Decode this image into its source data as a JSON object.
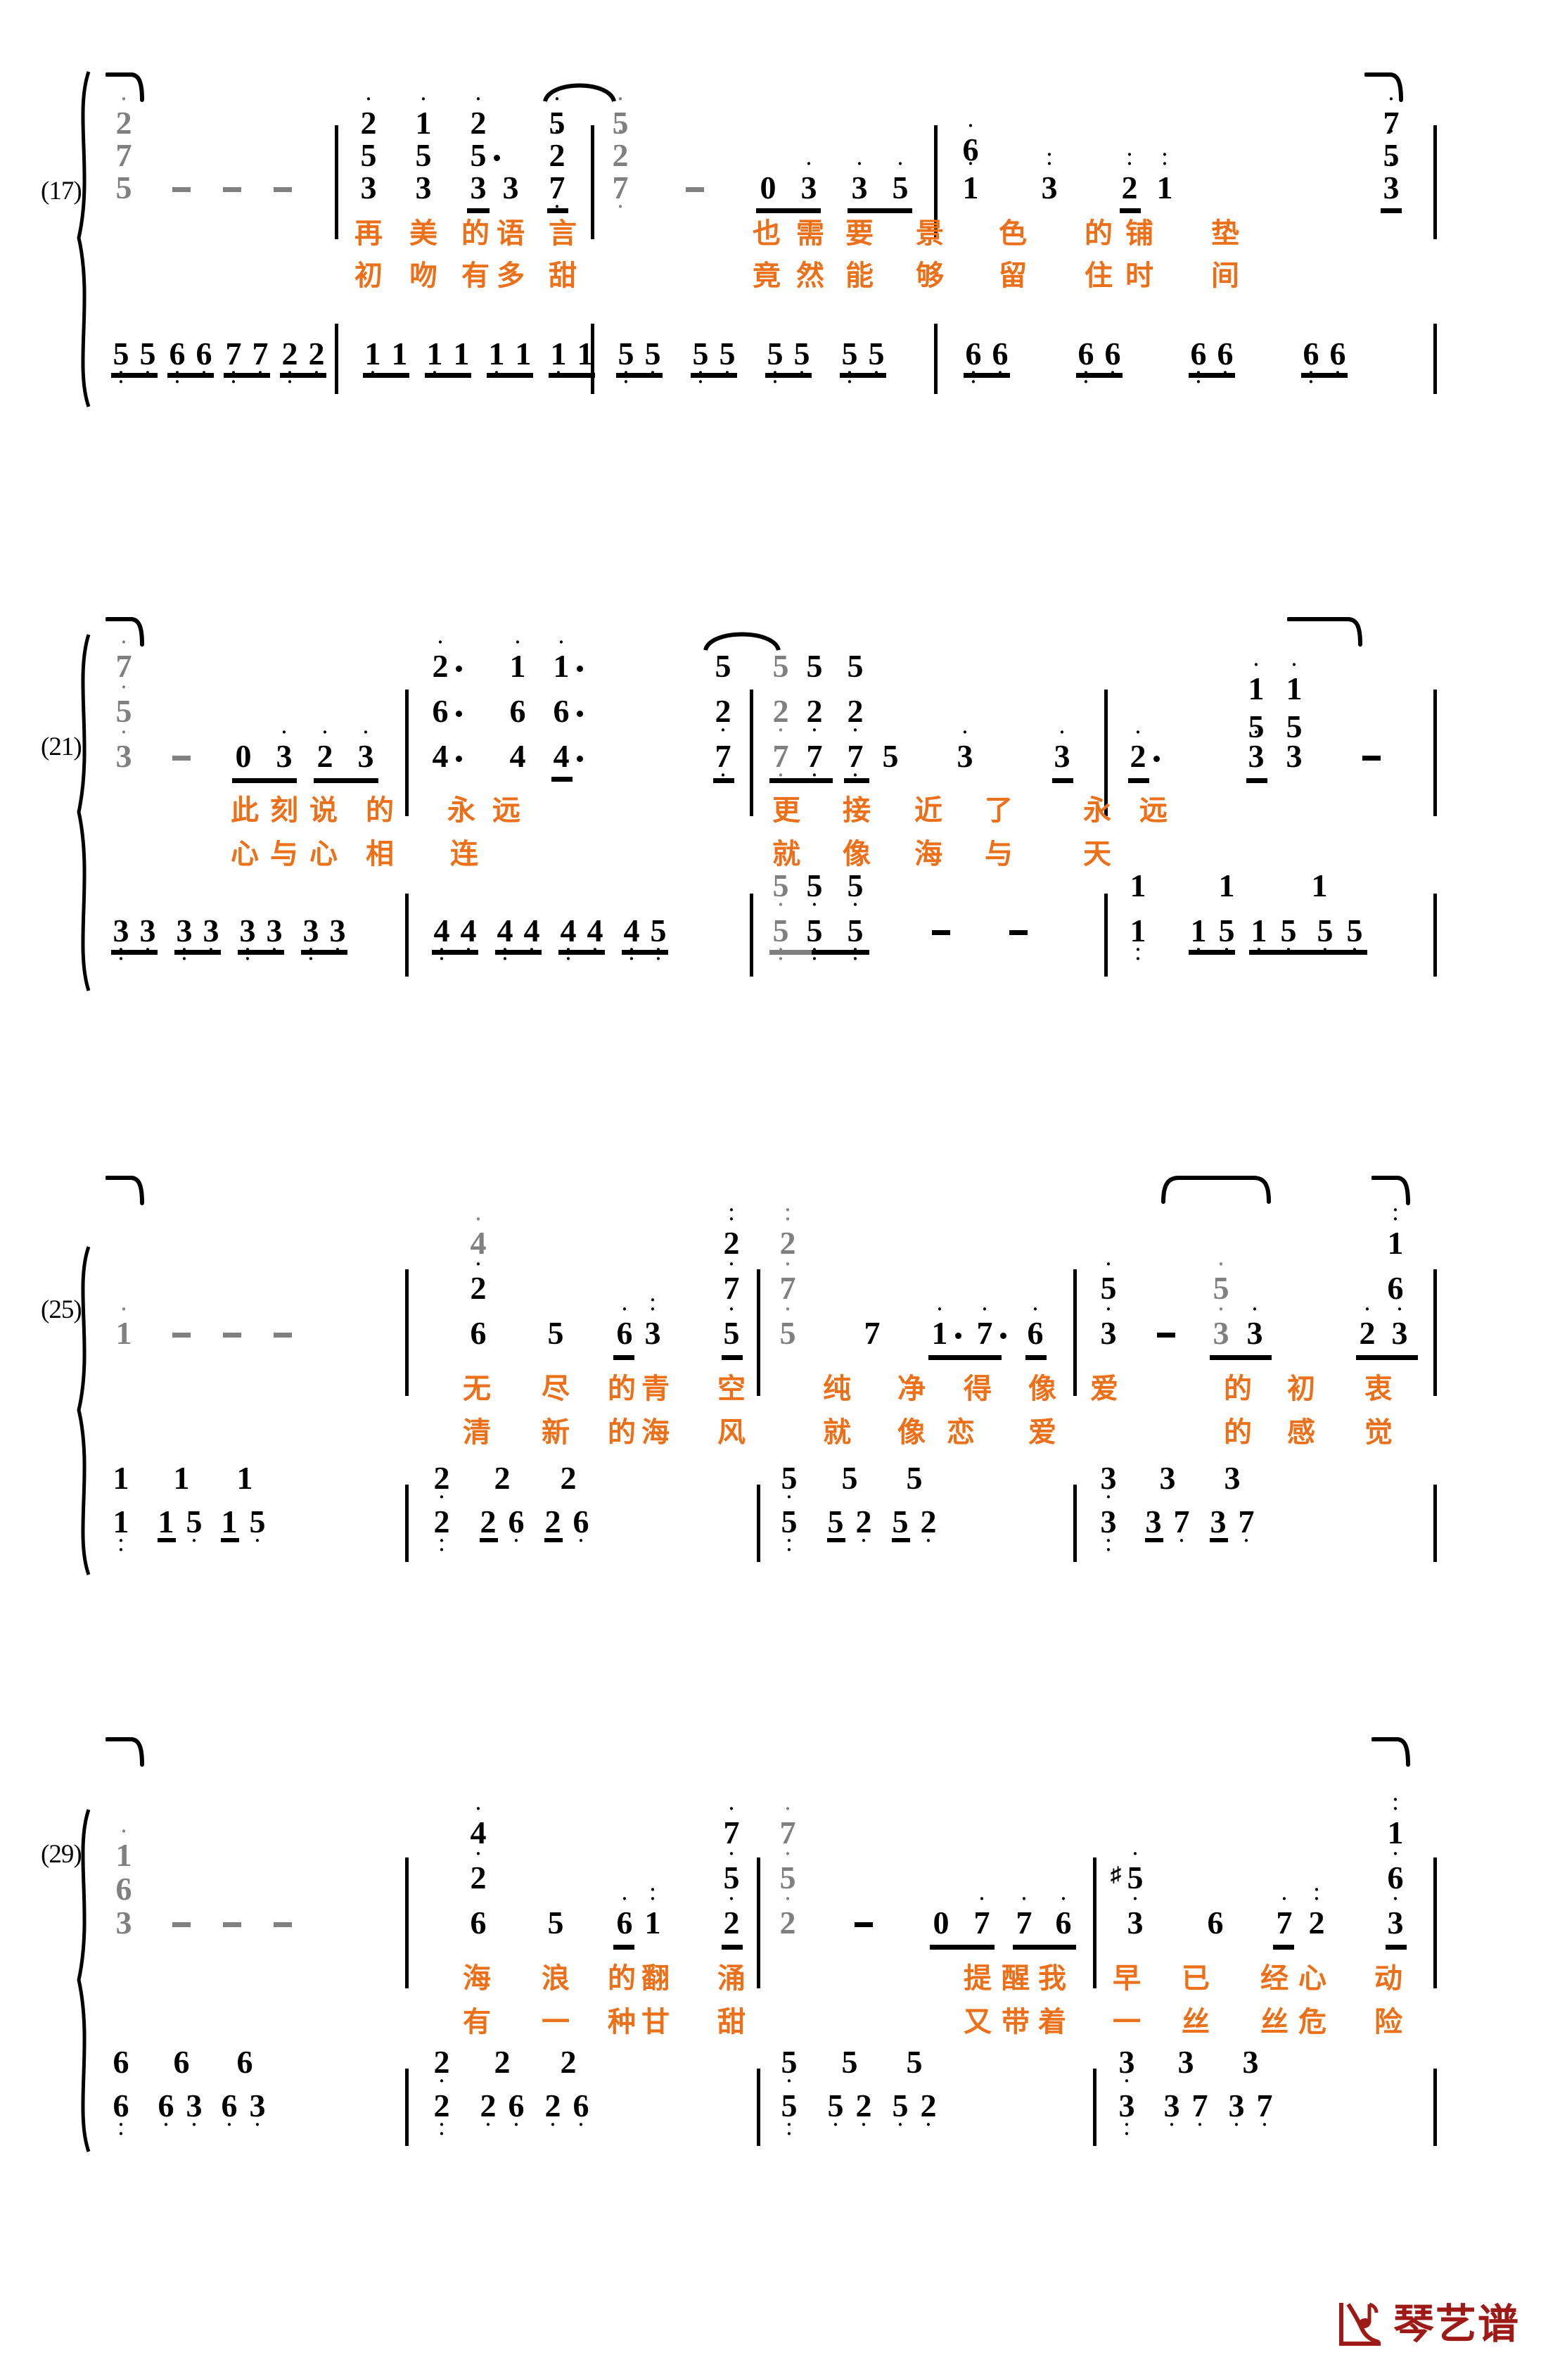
{
  "document": {
    "kind": "jianpu-piano-score",
    "notation": "Chinese numbered musical notation (简谱)",
    "accent_color": "#ec7019",
    "chord_grey_color": "#808080",
    "logo_color": "#9e1a16"
  },
  "logo": {
    "text": "琴艺谱",
    "icon": "piano-music-note-logo"
  },
  "systems": [
    {
      "measure_label": "(17)",
      "melody_tokens": [
        "2̇ / 7 / 5",
        "-",
        "-",
        "-",
        "2̇ / 5 / 3",
        "1̇ / 5 / 3",
        "2̇ / 5̇ / 3̇3",
        "5̇ / 2̇ / 7",
        "5̇ / 2̇ / 7",
        "-",
        "0 3̇ 3̇ 5̇",
        "6̇ / 1̇̇",
        "3̇̇",
        "2̇̇ 1̇̇",
        "7̇ / 5̇ / 3̇"
      ],
      "lyrics_line1": [
        "再",
        "美",
        "的",
        "语",
        "言",
        "",
        "也",
        "需",
        "要",
        "景",
        "色",
        "的",
        "铺",
        "垫"
      ],
      "lyrics_line2": [
        "初",
        "吻",
        "有",
        "多",
        "甜",
        "",
        "竟",
        "然",
        "能",
        "够",
        "留",
        "住",
        "时",
        "间"
      ],
      "bass_tokens": [
        "5 5 6 6 7 7 2 2",
        "1 1 1 1 1 1 1 1",
        "5 5 5 5 5 5 5 5",
        "6 6 6 6 6 6 6 6"
      ]
    },
    {
      "measure_label": "(21)",
      "melody_tokens": [
        "7̇ / 5 / 3",
        "-",
        "0 3̇ 2̇ 3̇",
        "2̇· / 6· / 4·",
        "1̇ / 6 / 4",
        "1̇· / 6· / 4·",
        "5̇ / 2̇ / 7̇",
        "5̇ / 2̇ / 7̇",
        "5 / 2 / 7",
        "5 / 2 / 7",
        "5",
        "3̇",
        "3̇",
        "2̇·",
        "1̇ / 5 / 3̇",
        "1̇ / 5 / 3̇",
        "-"
      ],
      "lyrics_line1": [
        "此",
        "刻",
        "说",
        "的",
        "",
        "永",
        "远",
        "",
        "更",
        "接",
        "近",
        "了",
        "",
        "永",
        "远"
      ],
      "lyrics_line2": [
        "心",
        "与",
        "心",
        "相",
        "",
        "连",
        "",
        "",
        "就",
        "",
        "像",
        "海",
        "与",
        "",
        "天"
      ],
      "bass_tokens": [
        "3 3 3 3 3 3 3 3",
        "4 4 4 4 4 4 4 5",
        "5̇ 5 5  - -",
        "1 1 5 1 5 5 5"
      ]
    },
    {
      "measure_label": "(25)",
      "melody_tokens": [
        "1̇",
        "-",
        "-",
        "-",
        "4̇ / 2̇ / 6",
        "5",
        "6̇ 3̇̇",
        "2̇̇ / 7̇ / 5̇",
        "2̇̇ / 7̇ / 5̇",
        "7",
        "1̇· 7̇· 6̇",
        "5̇ / 3̇",
        "-",
        "5̇ / 3̇ 3̇",
        "1̇̇ / 6 / 2̇ 3̇"
      ],
      "lyrics_line1": [
        "无",
        "尽",
        "的",
        "青",
        "空",
        "",
        "纯",
        "净",
        "得",
        "像",
        "爱",
        "",
        "的",
        "初",
        "衷"
      ],
      "lyrics_line2": [
        "清",
        "新",
        "的",
        "海",
        "风",
        "",
        "就",
        "像",
        "恋",
        "",
        "爱",
        "",
        "的",
        "感",
        "觉"
      ],
      "bass_tokens": [
        "1 / 1 ,  1 5 , 1 5",
        "2 / 2 , 2 6 , 2 6",
        "5 / 5 , 5 2 , 5 2",
        "3 / 3 , 3 7 , 3 7"
      ]
    },
    {
      "measure_label": "(29)",
      "melody_tokens": [
        "1̇ / 6 / 3",
        "-",
        "-",
        "-",
        "4̇ / 2̇ / 6",
        "5",
        "6̇ 1̇",
        "7̇ / 5̇ / 2̇",
        "7̇ / 5̇ / 2̇",
        "-",
        "0 7̇ 7̇ 6̇",
        "#5̇ / 3̇",
        "6",
        "7̇ 2̇",
        "1̇̇ / 6 / 3̇"
      ],
      "lyrics_line1": [
        "海",
        "浪",
        "的",
        "翻",
        "涌",
        "",
        "提",
        "醒",
        "我",
        "早",
        "已",
        "经",
        "心",
        "动"
      ],
      "lyrics_line2": [
        "有",
        "一",
        "种",
        "甘",
        "甜",
        "",
        "又",
        "带",
        "着",
        "一",
        "丝",
        "丝",
        "危",
        "险"
      ],
      "bass_tokens": [
        "6 / 6 , 6 3 , 6 3",
        "2 / 2 , 2 6 , 2 6",
        "5 / 5 , 5 2 , 5 2",
        "3 / 3 , 3 7 , 3 7"
      ]
    }
  ]
}
